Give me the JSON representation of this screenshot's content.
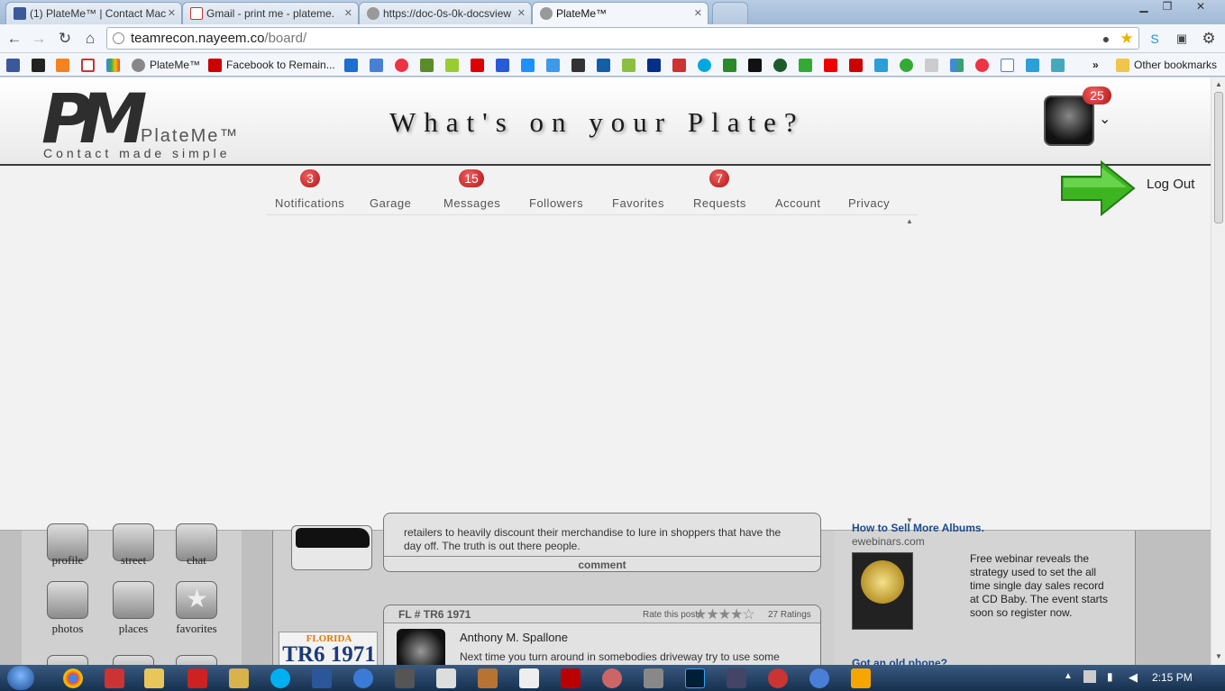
{
  "browser": {
    "tabs": [
      {
        "title": "(1) PlateMe™ | Contact Mac",
        "active": false
      },
      {
        "title": "Gmail - print me - plateme.",
        "active": false
      },
      {
        "title": "https://doc-0s-0k-docsview",
        "active": false
      },
      {
        "title": "PlateMe™",
        "active": true
      }
    ],
    "url_host": "teamrecon.nayeem.co",
    "url_path": "/board/",
    "bookmarks": {
      "plateme": "PlateMe™",
      "facebook": "Facebook to Remain...",
      "other": "Other bookmarks"
    }
  },
  "site": {
    "logo_name": "PlateMe™",
    "logo_tagline": "Contact made simple",
    "slogan": "What's on your Plate?",
    "profile_badge": "25",
    "logout": "Log Out",
    "nav": [
      {
        "label": "Notifications",
        "badge": "3"
      },
      {
        "label": "Garage",
        "badge": ""
      },
      {
        "label": "Messages",
        "badge": "15"
      },
      {
        "label": "Followers",
        "badge": ""
      },
      {
        "label": "Favorites",
        "badge": ""
      },
      {
        "label": "Requests",
        "badge": "7"
      },
      {
        "label": "Account",
        "badge": ""
      },
      {
        "label": "Privacy",
        "badge": ""
      }
    ]
  },
  "background": {
    "apps": [
      "profile",
      "street",
      "chat",
      "photos",
      "places",
      "favorites"
    ],
    "post1_text": "retailers to heavily discount their merchandise to lure in shoppers that have the day off. The truth is out there people.",
    "post1_comment": "comment",
    "post2_plate": "FL # TR6 1971",
    "post2_rate": "Rate this post",
    "post2_ratings": "27 Ratings",
    "post2_stars": 4,
    "post2_author": "Anthony M. Spallone",
    "post2_text": "Next time you turn around in somebodies driveway try to use some",
    "plate_state": "FLORIDA",
    "plate_number": "TR6 1971",
    "ad_title": "How to Sell More Albums.",
    "ad_domain": "ewebinars.com",
    "ad_text": "Free webinar reveals the strategy used to set the all time single day sales record at CD Baby. The event starts soon so register now.",
    "ad2_title": "Got an old phone?"
  },
  "taskbar": {
    "time": "2:15 PM"
  },
  "colors": {
    "badge_red": "#c41e1e",
    "arrow_green": "#3cb521"
  }
}
